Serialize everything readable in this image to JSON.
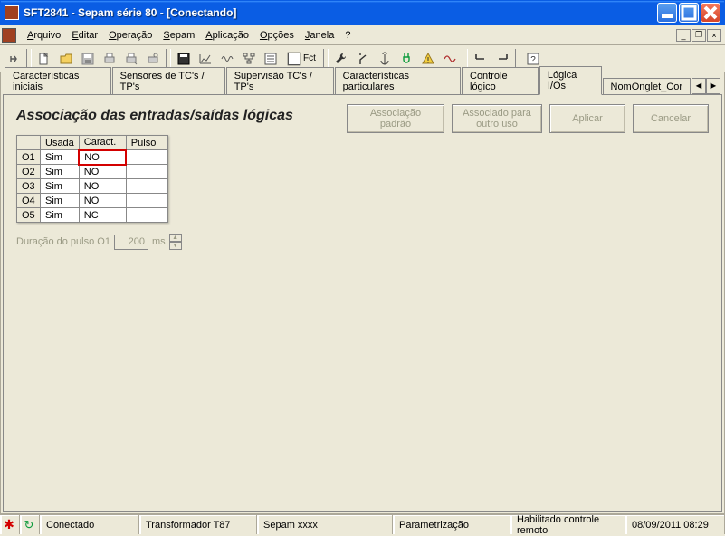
{
  "window": {
    "title": "SFT2841 - Sepam série 80 - [Conectando]"
  },
  "menu": {
    "arquivo": "Arquivo",
    "editar": "Editar",
    "operacao": "Operação",
    "sepam": "Sepam",
    "aplicacao": "Aplicação",
    "opcoes": "Opções",
    "janela": "Janela",
    "ajuda": "?"
  },
  "toolbar": {
    "fct_label": "Fct"
  },
  "tabs": {
    "items": [
      {
        "label": "Características iniciais"
      },
      {
        "label": "Sensores de TC's / TP's"
      },
      {
        "label": "Supervisão TC's / TP's"
      },
      {
        "label": "Características particulares"
      },
      {
        "label": "Controle lógico"
      },
      {
        "label": "Lógica I/Os"
      },
      {
        "label": "NomOnglet_Cor"
      }
    ],
    "active_index": 5
  },
  "page": {
    "title": "Associação das entradas/saídas lógicas",
    "btn_default": "Associação padrão",
    "btn_other": "Associado para outro uso",
    "btn_apply": "Aplicar",
    "btn_cancel": "Cancelar",
    "headers": {
      "out": "",
      "usada": "Usada",
      "caract": "Caract.",
      "pulso": "Pulso"
    },
    "rows": [
      {
        "out": "O1",
        "usada": "Sim",
        "caract": "NO",
        "pulso": ""
      },
      {
        "out": "O2",
        "usada": "Sim",
        "caract": "NO",
        "pulso": ""
      },
      {
        "out": "O3",
        "usada": "Sim",
        "caract": "NO",
        "pulso": ""
      },
      {
        "out": "O4",
        "usada": "Sim",
        "caract": "NO",
        "pulso": ""
      },
      {
        "out": "O5",
        "usada": "Sim",
        "caract": "NC",
        "pulso": ""
      }
    ],
    "pulse_label": "Duração do pulso O1",
    "pulse_value": "200",
    "pulse_unit": "ms"
  },
  "status": {
    "connected": "Conectado",
    "device": "Transformador T87",
    "sepam": "Sepam xxxx",
    "mode": "Parametrização",
    "remote": "Habilitado controle remoto",
    "datetime": "08/09/2011  08:29"
  }
}
